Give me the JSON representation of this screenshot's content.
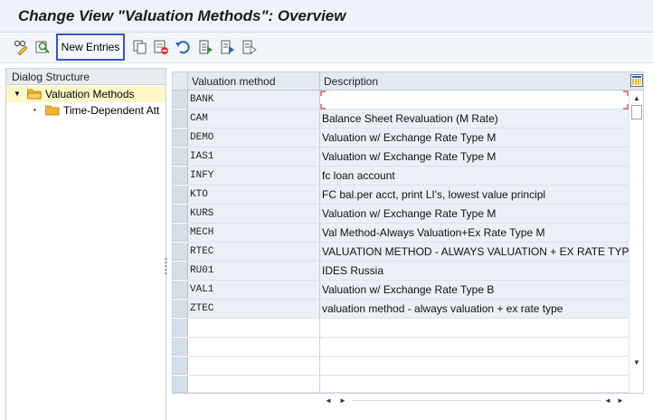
{
  "window": {
    "title": "Change View \"Valuation Methods\": Overview"
  },
  "toolbar": {
    "new_entries_label": "New Entries",
    "icons": [
      "display-change-icon",
      "find-icon",
      "copy-icon",
      "delete-icon",
      "undo-icon",
      "select-all-icon",
      "select-block-icon",
      "deselect-all-icon"
    ]
  },
  "dialog_structure": {
    "header": "Dialog Structure",
    "items": [
      {
        "label": "Valuation Methods",
        "selected": true
      },
      {
        "label": "Time-Dependent Att",
        "selected": false
      }
    ]
  },
  "table": {
    "columns": [
      "Valuation method",
      "Description"
    ],
    "rows": [
      {
        "method": "BANK",
        "description": ""
      },
      {
        "method": "CAM",
        "description": "Balance Sheet Revaluation (M Rate)"
      },
      {
        "method": "DEMO",
        "description": "Valuation w/ Exchange Rate Type M"
      },
      {
        "method": "IAS1",
        "description": "Valuation w/ Exchange Rate Type M"
      },
      {
        "method": "INFY",
        "description": "fc loan account"
      },
      {
        "method": "KTO",
        "description": "FC bal.per acct, print LI's, lowest value principl"
      },
      {
        "method": "KURS",
        "description": "Valuation w/ Exchange Rate Type M"
      },
      {
        "method": "MECH",
        "description": "Val Method-Always Valuation+Ex Rate Type M"
      },
      {
        "method": "RTEC",
        "description": "VALUATION METHOD - ALWAYS VALUATION + EX RATE TYPE"
      },
      {
        "method": "RU01",
        "description": "IDES Russia"
      },
      {
        "method": "VAL1",
        "description": "Valuation w/ Exchange Rate Type B"
      },
      {
        "method": "ZTEC",
        "description": "valuation method - always valuation + ex rate type"
      }
    ]
  }
}
